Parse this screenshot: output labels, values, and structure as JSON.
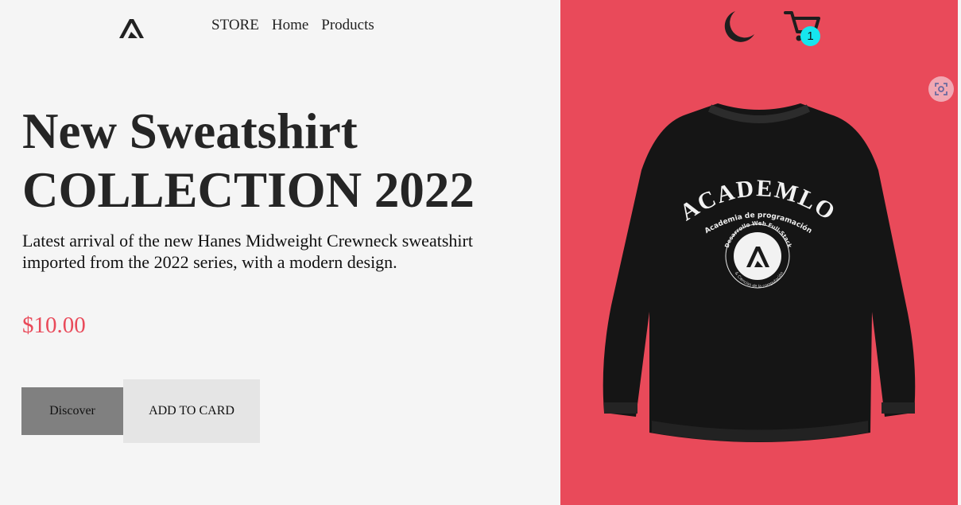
{
  "nav": {
    "logo_icon": "academlo-logo-icon",
    "items": [
      {
        "label": "STORE"
      },
      {
        "label": "Home"
      },
      {
        "label": "Products"
      }
    ]
  },
  "hero": {
    "title_line1": "New Sweatshirt",
    "title_line2": "COLLECTION 2022",
    "description": "Latest arrival of the new Hanes Midweight Crewneck sweatshirt imported from the 2022 series, with a modern design.",
    "price": "$10.00"
  },
  "buttons": {
    "discover_label": "Discover",
    "add_label": "ADD TO CARD"
  },
  "header_right": {
    "theme_icon": "moon-icon",
    "cart_icon": "cart-icon",
    "cart_count": "1"
  },
  "product_image": {
    "brand": "ACADEMLO",
    "tagline": "Academia de programación",
    "ring_top": "Desarrollo Web Full-Stack",
    "ring_bottom": "& Ciencias de la computación"
  },
  "colors": {
    "accent": "#e94a5a",
    "badge": "#16e6ee",
    "background": "#f5f5f5",
    "discover_button": "#808080",
    "add_button": "#e5e5e5"
  }
}
